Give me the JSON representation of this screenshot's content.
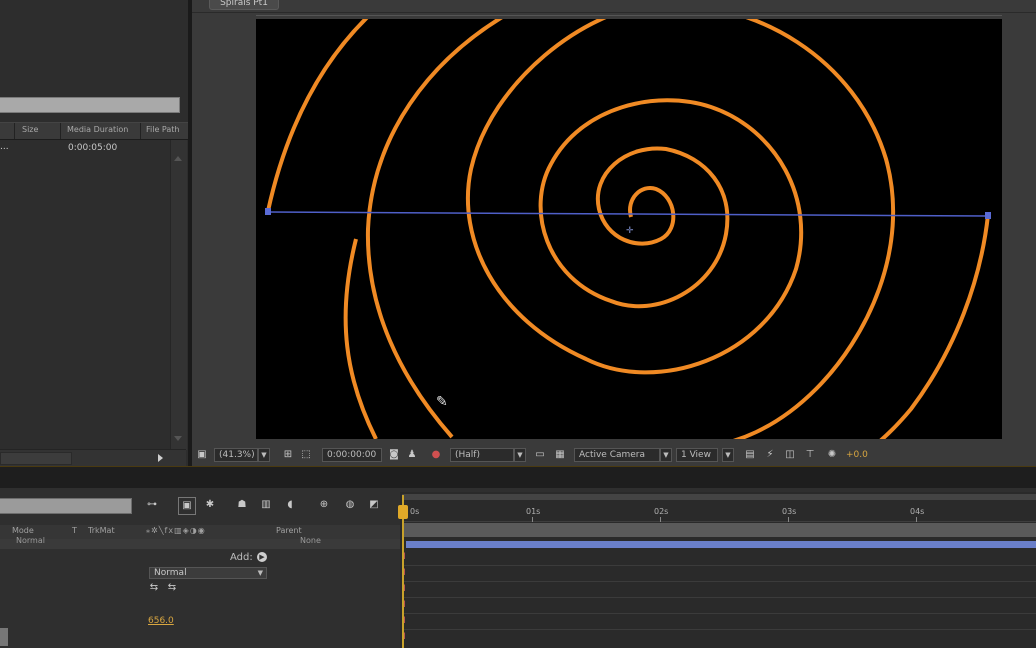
{
  "comp": {
    "tab_label": "Spirals Pt1",
    "zoom": "(41.3%)",
    "timecode": "0:00:00:00",
    "resolution": "(Half)",
    "camera": "Active Camera",
    "views": "1 View",
    "exposure": "+0.0"
  },
  "project": {
    "columns": {
      "size": "Size",
      "media_duration": "Media Duration",
      "file_path": "File Path"
    },
    "row": {
      "name": "...",
      "duration": "0:00:05:00"
    }
  },
  "timeline": {
    "columns": {
      "mode": "Mode",
      "t": "T",
      "trkmat": "TrkMat",
      "parent": "Parent"
    },
    "row_mode_value": "Normal",
    "row_parent_value": "None",
    "add_label": "Add:",
    "mode_dropdown": "Normal",
    "stroke_value": "656.0",
    "ruler": [
      "0s",
      "01s",
      "02s",
      "03s",
      "04s"
    ]
  },
  "colors": {
    "spiral": "#f08a24",
    "path": "#4f5fc8",
    "layer_bar": "#6a7fc9",
    "playhead": "#e0a928",
    "value_text": "#d8a640"
  }
}
